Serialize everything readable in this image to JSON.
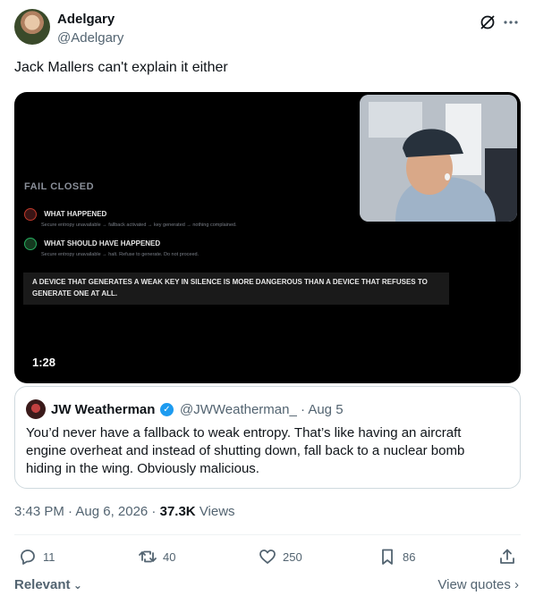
{
  "author": {
    "name": "Adelgary",
    "handle": "@Adelgary"
  },
  "header": {
    "grok_icon": "slash-circle-icon",
    "more_icon": "more-icon"
  },
  "post": {
    "text": "Jack Mallers can't explain it either"
  },
  "video": {
    "duration": "1:28",
    "slide": {
      "title": "FAIL CLOSED",
      "items": [
        {
          "label": "WHAT HAPPENED",
          "detail": "Secure entropy unavailable → fallback activated → key generated → nothing complained.",
          "status_color": "#c0392b"
        },
        {
          "label": "WHAT SHOULD HAVE HAPPENED",
          "detail": "Secure entropy unavailable → halt. Refuse to generate. Do not proceed.",
          "status_color": "#27ae60"
        }
      ],
      "quote": "A DEVICE THAT GENERATES A WEAK KEY IN SILENCE IS MORE DANGEROUS THAN A DEVICE THAT REFUSES TO GENERATE ONE AT ALL."
    }
  },
  "quoted": {
    "name": "JW Weatherman",
    "handle": "@JWWeatherman_",
    "date": "· Aug 5",
    "text": "You’d never have a fallback to weak entropy. That’s like having an aircraft engine overheat and instead of shutting down, fall back to a nuclear bomb hiding in the wing. Obviously malicious."
  },
  "meta": {
    "time": "3:43 PM · Aug 6, 2026 ·",
    "views_count": "37.3K",
    "views_label": "Views"
  },
  "actions": {
    "replies": "11",
    "reposts": "40",
    "likes": "250",
    "bookmarks": "86"
  },
  "footer": {
    "sort": "Relevant",
    "view_quotes": "View quotes"
  },
  "colors": {
    "accent": "#1d9bf0",
    "secondary": "#536471"
  }
}
